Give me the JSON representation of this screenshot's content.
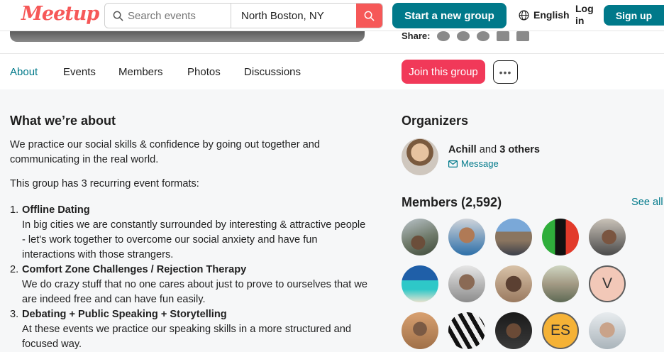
{
  "header": {
    "logo": "Meetup",
    "search_placeholder": "Search events",
    "location_value": "North Boston, NY",
    "start_group": "Start a new group",
    "language": "English",
    "login": "Log in",
    "signup": "Sign up"
  },
  "share": {
    "label": "Share:"
  },
  "tabs": [
    {
      "label": "About"
    },
    {
      "label": "Events"
    },
    {
      "label": "Members"
    },
    {
      "label": "Photos"
    },
    {
      "label": "Discussions"
    }
  ],
  "actions": {
    "join": "Join this group",
    "more": "•••"
  },
  "about": {
    "title": "What we’re about",
    "intro": "We practice our social skills & confidence by going out together and communicating in the real world.",
    "formats_intro": "This group has 3 recurring event formats:",
    "formats": [
      {
        "num": "1.",
        "title": "Offline Dating",
        "desc": "In big cities we are constantly surrounded by interesting & attractive people - let's work together to overcome our social anxiety and have fun interactions with those strangers."
      },
      {
        "num": "2.",
        "title": "Comfort Zone Challenges / Rejection Therapy",
        "desc": "We do crazy stuff that no one cares about just to prove to ourselves that we are indeed free and can have fun easily."
      },
      {
        "num": "3.",
        "title": "Debating + Public Speaking + Storytelling",
        "desc": "At these events we practice our speaking skills in a more structured and focused way."
      }
    ]
  },
  "organizers": {
    "title": "Organizers",
    "name": "Achill",
    "and": "and",
    "others": "3 others",
    "message": "Message"
  },
  "members": {
    "title": "Members (2,592)",
    "see_all": "See all",
    "initials": {
      "v": "V",
      "es": "ES"
    }
  },
  "colors": {
    "brand": "#f65858",
    "teal": "#00798a",
    "join": "#f13959"
  }
}
